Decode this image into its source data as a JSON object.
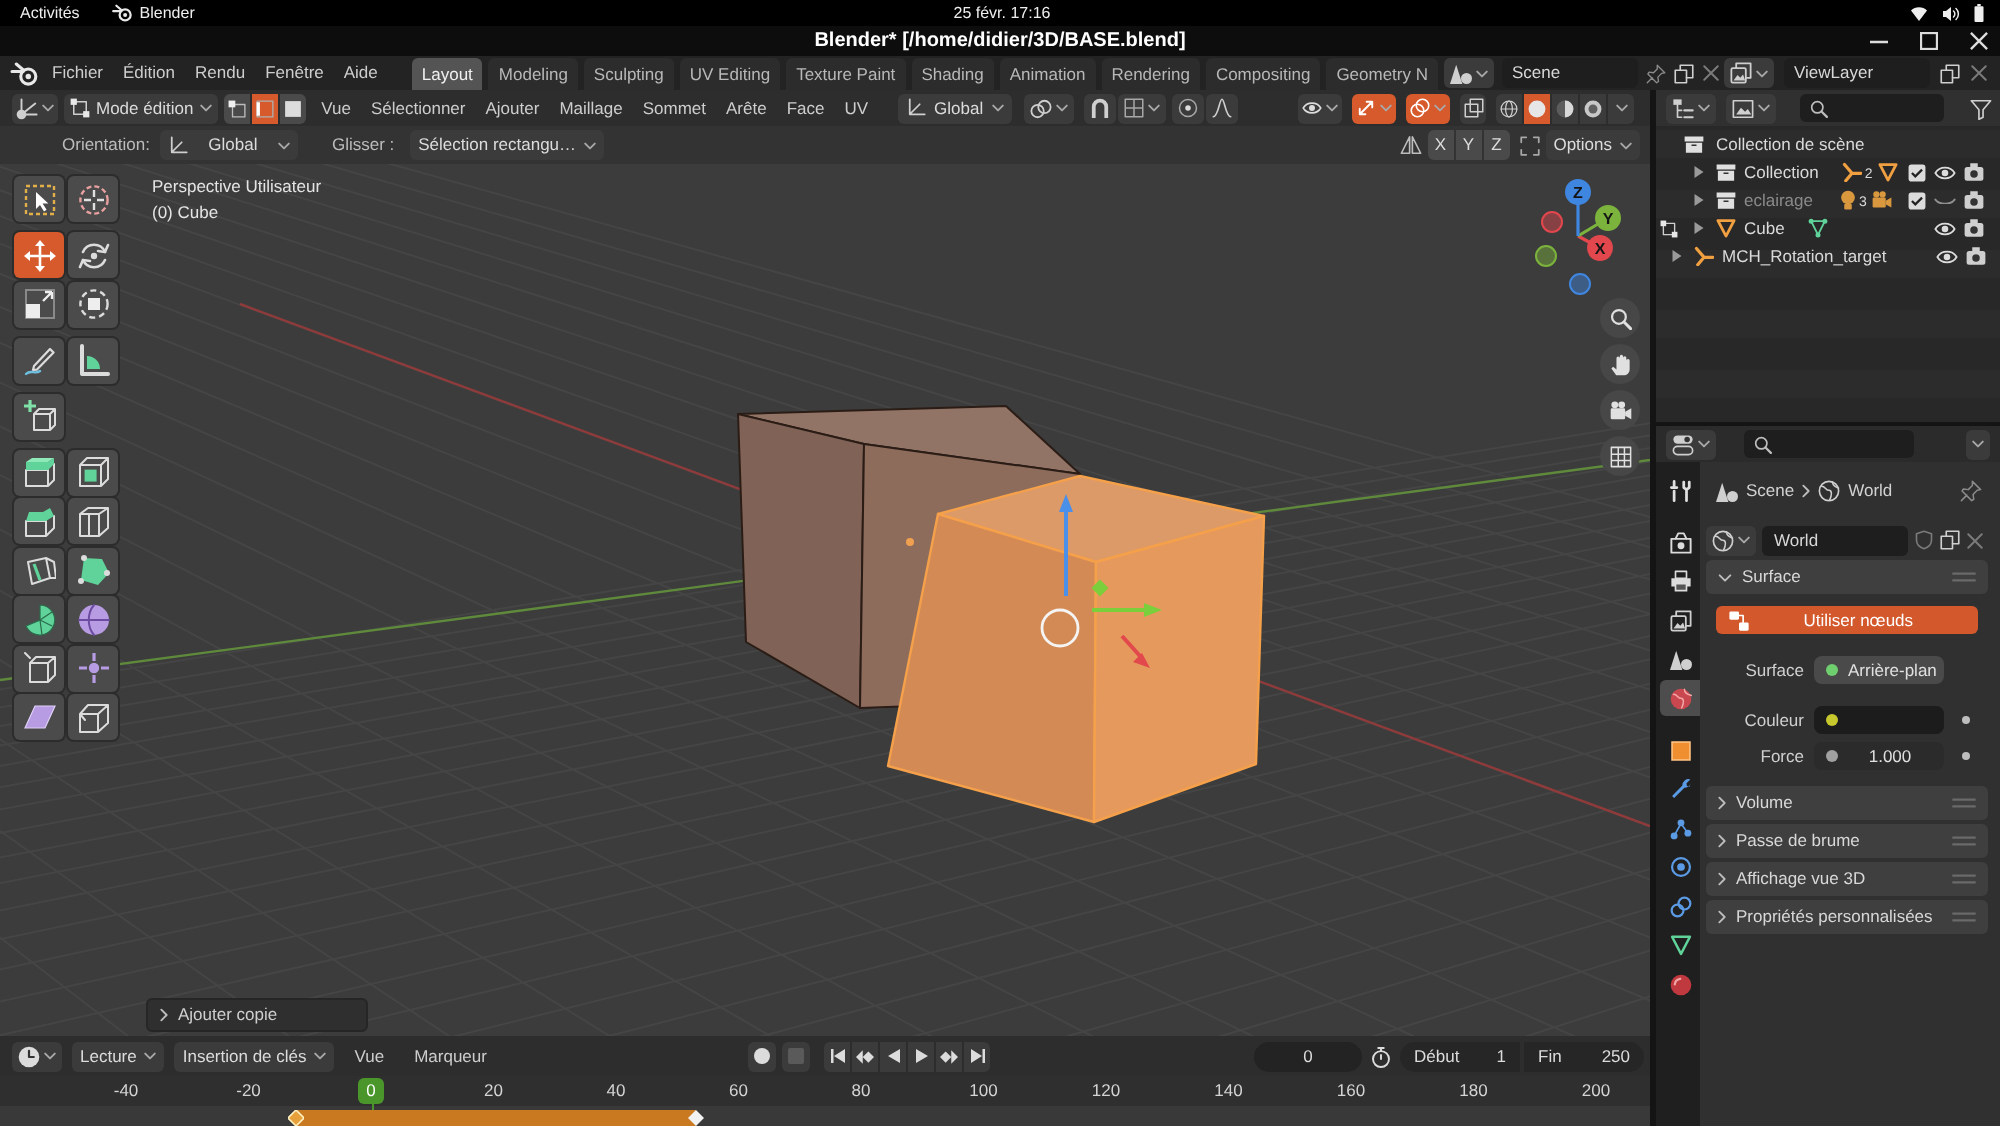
{
  "system_bar": {
    "activities": "Activités",
    "app": "Blender",
    "clock": "25 févr. 17:16"
  },
  "window": {
    "title": "Blender* [/home/didier/3D/BASE.blend]"
  },
  "top_bar": {
    "menus": [
      "Fichier",
      "Édition",
      "Rendu",
      "Fenêtre",
      "Aide"
    ],
    "workspaces": [
      {
        "label": "Layout",
        "selected": true
      },
      {
        "label": "Modeling",
        "selected": false
      },
      {
        "label": "Sculpting",
        "selected": false
      },
      {
        "label": "UV Editing",
        "selected": false
      },
      {
        "label": "Texture Paint",
        "selected": false
      },
      {
        "label": "Shading",
        "selected": false
      },
      {
        "label": "Animation",
        "selected": false
      },
      {
        "label": "Rendering",
        "selected": false
      },
      {
        "label": "Compositing",
        "selected": false
      },
      {
        "label": "Geometry N",
        "selected": false
      }
    ],
    "scene": "Scene",
    "view_layer": "ViewLayer"
  },
  "viewport_header": {
    "mode": "Mode édition",
    "select_modes": [
      {
        "kind": "vertex",
        "selected": false
      },
      {
        "kind": "edge",
        "selected": true
      },
      {
        "kind": "face",
        "selected": false
      }
    ],
    "menus": [
      "Vue",
      "Sélectionner",
      "Ajouter",
      "Maillage",
      "Sommet",
      "Arête",
      "Face",
      "UV"
    ],
    "orientation": "Global",
    "toggles": [
      {
        "kind": "visibility",
        "on": false
      },
      {
        "kind": "gizmo",
        "on": true
      },
      {
        "kind": "overlay",
        "on": true
      },
      {
        "kind": "xray",
        "on": false
      }
    ],
    "shading": [
      {
        "kind": "wireframe",
        "selected": false
      },
      {
        "kind": "solid",
        "selected": true
      },
      {
        "kind": "material",
        "selected": false
      },
      {
        "kind": "rendered",
        "selected": false
      }
    ]
  },
  "tool_settings": {
    "orientation_label": "Orientation:",
    "orientation": "Global",
    "drag_label": "Glisser :",
    "drag": "Sélection rectangu…",
    "axes": [
      {
        "label": "X",
        "on": false
      },
      {
        "label": "Y",
        "on": false
      },
      {
        "label": "Z",
        "on": false
      }
    ],
    "options": "Options"
  },
  "viewport": {
    "view_name": "Perspective Utilisateur",
    "object_name": "(0) Cube",
    "tools": [
      [
        {
          "kind": "select",
          "selected": false
        },
        {
          "kind": "cursor",
          "selected": false
        }
      ],
      [
        {
          "kind": "move",
          "selected": true
        },
        {
          "kind": "rotate",
          "selected": false
        },
        {
          "kind": "scale",
          "selected": false
        },
        {
          "kind": "transform",
          "selected": false
        }
      ],
      [
        {
          "kind": "annotate",
          "selected": false
        },
        {
          "kind": "measure",
          "selected": false
        }
      ],
      [
        {
          "kind": "add_cube",
          "selected": false
        }
      ],
      [
        {
          "kind": "extrude",
          "selected": false
        },
        {
          "kind": "inset",
          "selected": false
        },
        {
          "kind": "bevel",
          "selected": false
        },
        {
          "kind": "loop_cut",
          "selected": false
        },
        {
          "kind": "knife",
          "selected": false
        },
        {
          "kind": "poly_build",
          "selected": false
        },
        {
          "kind": "spin",
          "selected": false
        },
        {
          "kind": "smooth",
          "selected": false
        },
        {
          "kind": "edge_slide",
          "selected": false
        },
        {
          "kind": "shrink_fatten",
          "selected": false
        },
        {
          "kind": "shear",
          "selected": false
        },
        {
          "kind": "rip",
          "selected": false
        }
      ]
    ],
    "nav_gizmo": [
      {
        "label": "X",
        "color": "#e2474e"
      },
      {
        "label": "Y",
        "color": "#7cb33d"
      },
      {
        "label": "Z",
        "color": "#3f86e0"
      }
    ],
    "last_operator": {
      "label": "Ajouter copie",
      "expanded": false
    }
  },
  "outliner": {
    "root": {
      "label": "Collection de scène",
      "children": [
        {
          "label": "Collection",
          "kind": "collection",
          "expanded": false,
          "checked": true,
          "visible": true,
          "contents": [
            {
              "kind": "armature",
              "count": "2"
            },
            {
              "kind": "mesh"
            }
          ]
        },
        {
          "label": "eclairage",
          "kind": "collection",
          "expanded": false,
          "checked": true,
          "visible": false,
          "contents": [
            {
              "kind": "light",
              "count": "3"
            },
            {
              "kind": "camera"
            }
          ]
        },
        {
          "label": "Cube",
          "kind": "mesh",
          "expanded": false,
          "visible": true,
          "editing": true,
          "contents": [
            {
              "kind": "mesh_data"
            }
          ]
        },
        {
          "label": "MCH_Rotation_target",
          "kind": "armature",
          "expanded": false,
          "visible": true,
          "editing": false
        }
      ]
    }
  },
  "properties": {
    "tabs": [
      [
        {
          "kind": "tool",
          "selected": false
        }
      ],
      [
        {
          "kind": "render",
          "selected": false
        },
        {
          "kind": "output",
          "selected": false
        },
        {
          "kind": "view_layer",
          "selected": false
        },
        {
          "kind": "scene",
          "selected": false
        },
        {
          "kind": "world",
          "selected": true
        }
      ],
      [
        {
          "kind": "object",
          "selected": false
        },
        {
          "kind": "modifiers",
          "selected": false
        },
        {
          "kind": "particles",
          "selected": false
        },
        {
          "kind": "physics",
          "selected": false
        },
        {
          "kind": "constraints",
          "selected": false
        },
        {
          "kind": "data",
          "selected": false
        },
        {
          "kind": "material",
          "selected": false
        }
      ]
    ],
    "breadcrumb": [
      {
        "label": "Scene",
        "kind": "scene"
      },
      {
        "label": "World",
        "kind": "world"
      }
    ],
    "datablock": "World",
    "panels": [
      {
        "title": "Surface",
        "expanded": true,
        "button": "Utiliser nœuds",
        "fields": [
          {
            "label": "Surface",
            "kind": "link",
            "value": "Arrière-plan",
            "color": "#6fcf6f"
          },
          {
            "label": "Couleur",
            "kind": "color",
            "color": "#c7c72e"
          },
          {
            "label": "Force",
            "kind": "number",
            "value": "1.000",
            "color": "#a0a0a0"
          }
        ]
      },
      {
        "title": "Volume",
        "expanded": false
      },
      {
        "title": "Passe de brume",
        "expanded": false
      },
      {
        "title": "Affichage vue 3D",
        "expanded": false
      },
      {
        "title": "Propriétés personnalisées",
        "expanded": false
      }
    ]
  },
  "timeline": {
    "menus": [
      {
        "label": "Lecture",
        "kind": "dropdown"
      },
      {
        "label": "Insertion de clés",
        "kind": "dropdown"
      },
      {
        "label": "Vue",
        "kind": "menu"
      },
      {
        "label": "Marqueur",
        "kind": "menu"
      }
    ],
    "current_frame": "0",
    "start_label": "Début",
    "start": "1",
    "end_label": "Fin",
    "end": "250",
    "ruler": [
      {
        "label": "-40",
        "kind": "tick"
      },
      {
        "label": "-20",
        "kind": "tick"
      },
      {
        "label": "0",
        "kind": "playhead"
      },
      {
        "label": "20",
        "kind": "tick"
      },
      {
        "label": "40",
        "kind": "tick"
      },
      {
        "label": "60",
        "kind": "tick"
      },
      {
        "label": "80",
        "kind": "tick"
      },
      {
        "label": "100",
        "kind": "tick"
      },
      {
        "label": "120",
        "kind": "tick"
      },
      {
        "label": "140",
        "kind": "tick"
      },
      {
        "label": "160",
        "kind": "tick"
      },
      {
        "label": "180",
        "kind": "tick"
      },
      {
        "label": "200",
        "kind": "tick"
      }
    ]
  }
}
